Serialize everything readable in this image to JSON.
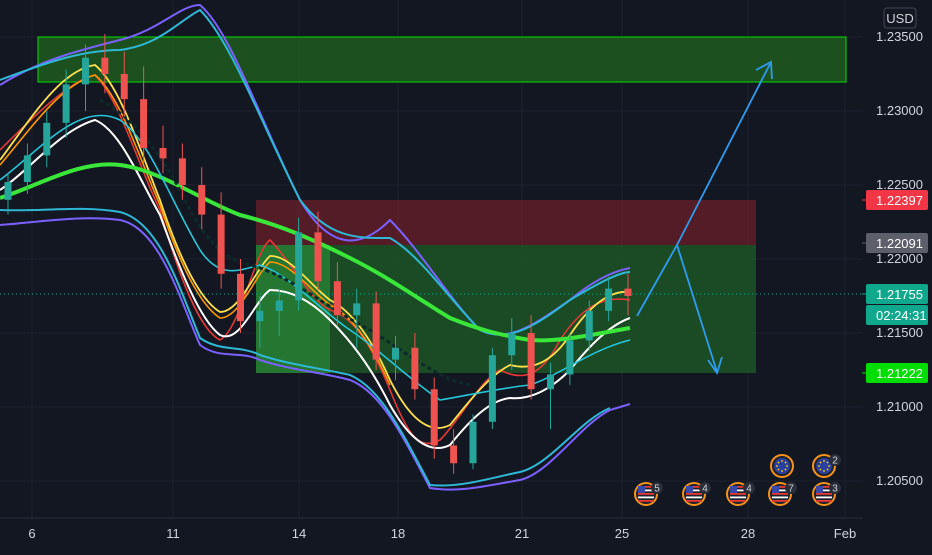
{
  "colors": {
    "background": "#131722",
    "grid": "#1e222d",
    "bull": "#26a69a",
    "bear": "#ef5350",
    "upper_zone": "#00c800",
    "stop_zone": "#8b2330",
    "target_zone": "#1f7a2a",
    "arrow": "#2f9bf0",
    "tag_red": "#f23645",
    "tag_gray": "#5d606b",
    "tag_teal": "#0fa88d",
    "tag_green": "#00dd00"
  },
  "axis": {
    "currency": "USD",
    "price_ticks": [
      "1.23500",
      "1.23000",
      "1.22500",
      "1.22000",
      "1.21500",
      "1.21000",
      "1.20500"
    ],
    "date_ticks": [
      "6",
      "11",
      "14",
      "18",
      "21",
      "25",
      "28",
      "Feb"
    ]
  },
  "price_tags": [
    {
      "id": "stop",
      "label": "1.22397",
      "color": "#f23645"
    },
    {
      "id": "entry",
      "label": "1.22091",
      "color": "#5d606b"
    },
    {
      "id": "last",
      "label": "1.21755",
      "color": "#0fa88d"
    },
    {
      "id": "countdown",
      "label": "02:24:31",
      "color": "#0fa88d"
    },
    {
      "id": "target",
      "label": "1.21222",
      "color": "#00dd00"
    }
  ],
  "events": [
    {
      "flag": "us",
      "count": "5"
    },
    {
      "flag": "us",
      "count": "4"
    },
    {
      "flag": "us",
      "count": "4"
    },
    {
      "flag": "us",
      "count": "7"
    },
    {
      "flag": "us",
      "count": "3"
    },
    {
      "flag": "eu",
      "count": ""
    },
    {
      "flag": "eu",
      "count": "2"
    }
  ],
  "chart_data": {
    "type": "candlestick",
    "symbol_currency": "USD",
    "ylim": [
      1.2025,
      1.2375
    ],
    "date_ticks": [
      "6",
      "11",
      "14",
      "18",
      "21",
      "25",
      "28",
      "Feb"
    ],
    "candles": [
      {
        "o": 1.224,
        "h": 1.2258,
        "l": 1.223,
        "c": 1.2252
      },
      {
        "o": 1.2252,
        "h": 1.2278,
        "l": 1.2244,
        "c": 1.227
      },
      {
        "o": 1.227,
        "h": 1.23,
        "l": 1.2262,
        "c": 1.2292
      },
      {
        "o": 1.2292,
        "h": 1.2328,
        "l": 1.2282,
        "c": 1.2318
      },
      {
        "o": 1.2318,
        "h": 1.2345,
        "l": 1.23,
        "c": 1.2336
      },
      {
        "o": 1.2336,
        "h": 1.2352,
        "l": 1.2312,
        "c": 1.2325
      },
      {
        "o": 1.2325,
        "h": 1.234,
        "l": 1.2296,
        "c": 1.2308
      },
      {
        "o": 1.2308,
        "h": 1.233,
        "l": 1.2265,
        "c": 1.2275
      },
      {
        "o": 1.2275,
        "h": 1.229,
        "l": 1.2258,
        "c": 1.2268
      },
      {
        "o": 1.2268,
        "h": 1.2278,
        "l": 1.224,
        "c": 1.225
      },
      {
        "o": 1.225,
        "h": 1.2262,
        "l": 1.222,
        "c": 1.223
      },
      {
        "o": 1.223,
        "h": 1.2245,
        "l": 1.218,
        "c": 1.219
      },
      {
        "o": 1.219,
        "h": 1.22,
        "l": 1.215,
        "c": 1.2158
      },
      {
        "o": 1.2158,
        "h": 1.2175,
        "l": 1.214,
        "c": 1.2165
      },
      {
        "o": 1.2165,
        "h": 1.218,
        "l": 1.2148,
        "c": 1.2172
      },
      {
        "o": 1.2172,
        "h": 1.2228,
        "l": 1.2165,
        "c": 1.2218
      },
      {
        "o": 1.2218,
        "h": 1.2232,
        "l": 1.2178,
        "c": 1.2185
      },
      {
        "o": 1.2185,
        "h": 1.2198,
        "l": 1.2155,
        "c": 1.2162
      },
      {
        "o": 1.2162,
        "h": 1.218,
        "l": 1.214,
        "c": 1.217
      },
      {
        "o": 1.217,
        "h": 1.2178,
        "l": 1.2125,
        "c": 1.2132
      },
      {
        "o": 1.2132,
        "h": 1.2148,
        "l": 1.2118,
        "c": 1.214
      },
      {
        "o": 1.214,
        "h": 1.215,
        "l": 1.2105,
        "c": 1.2112
      },
      {
        "o": 1.2112,
        "h": 1.212,
        "l": 1.2065,
        "c": 1.2074
      },
      {
        "o": 1.2074,
        "h": 1.2085,
        "l": 1.2055,
        "c": 1.2062
      },
      {
        "o": 1.2062,
        "h": 1.2095,
        "l": 1.2058,
        "c": 1.209
      },
      {
        "o": 1.209,
        "h": 1.214,
        "l": 1.2085,
        "c": 1.2135
      },
      {
        "o": 1.2135,
        "h": 1.216,
        "l": 1.2125,
        "c": 1.215
      },
      {
        "o": 1.215,
        "h": 1.2162,
        "l": 1.2105,
        "c": 1.2112
      },
      {
        "o": 1.2112,
        "h": 1.213,
        "l": 1.2085,
        "c": 1.2122
      },
      {
        "o": 1.2122,
        "h": 1.215,
        "l": 1.2115,
        "c": 1.2145
      },
      {
        "o": 1.2145,
        "h": 1.2172,
        "l": 1.2138,
        "c": 1.2165
      },
      {
        "o": 1.2165,
        "h": 1.2188,
        "l": 1.2158,
        "c": 1.218
      },
      {
        "o": 1.218,
        "h": 1.219,
        "l": 1.2162,
        "c": 1.2175
      }
    ],
    "zones": [
      {
        "name": "upper",
        "from": 1.232,
        "to": 1.235
      },
      {
        "name": "stop",
        "from": 1.22091,
        "to": 1.22397
      },
      {
        "name": "target",
        "from": 1.21222,
        "to": 1.22091
      }
    ],
    "levels": {
      "stop": 1.22397,
      "entry": 1.22091,
      "last": 1.21755,
      "target": 1.21222
    }
  }
}
